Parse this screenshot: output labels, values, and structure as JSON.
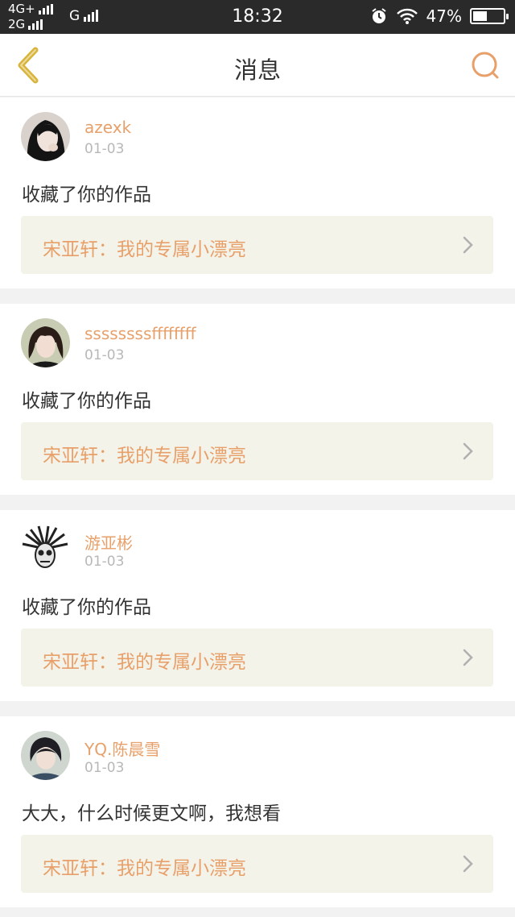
{
  "status": {
    "network_top": "4G+",
    "network_bottom": "2G",
    "carrier_g": "G",
    "time": "18:32",
    "battery": "47%",
    "battery_level": 0.47
  },
  "header": {
    "title": "消息",
    "back_icon": "chevron-left-icon",
    "search_icon": "search-icon"
  },
  "colors": {
    "accent": "#e8a06a",
    "back_icon": "#d9b43a",
    "ref_bg": "#f4f3ea"
  },
  "messages": [
    {
      "user": "azexk",
      "date": "01-03",
      "text": "收藏了你的作品",
      "ref": "宋亚轩：我的专属小漂亮"
    },
    {
      "user": "ssssssssffffffff",
      "date": "01-03",
      "text": "收藏了你的作品",
      "ref": "宋亚轩：我的专属小漂亮"
    },
    {
      "user": "游亚彬",
      "date": "01-03",
      "text": "收藏了你的作品",
      "ref": "宋亚轩：我的专属小漂亮"
    },
    {
      "user": "YQ.陈晨雪",
      "date": "01-03",
      "text": "大大，什么时候更文啊，我想看",
      "ref": "宋亚轩：我的专属小漂亮"
    }
  ]
}
